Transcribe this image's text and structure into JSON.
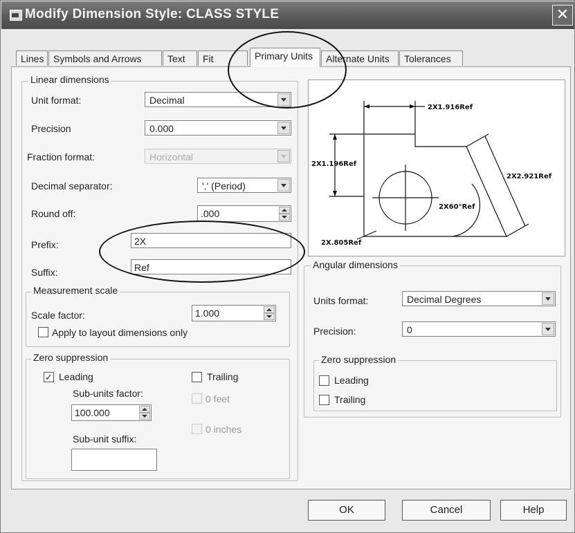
{
  "title": "Modify Dimension Style: CLASS STYLE",
  "tabs": [
    "Lines",
    "Symbols and Arrows",
    "Text",
    "Fit",
    "Primary Units",
    "Alternate Units",
    "Tolerances"
  ],
  "linear": {
    "group_label": "Linear dimensions",
    "unit_format_label": "Unit format:",
    "unit_format_value": "Decimal",
    "precision_label": "Precision",
    "precision_value": "0.000",
    "fraction_format_label": "Fraction format:",
    "fraction_format_value": "Horizontal",
    "decimal_separator_label": "Decimal separator:",
    "decimal_separator_value": "'.' (Period)",
    "round_off_label": "Round off:",
    "round_off_value": ".000",
    "prefix_label": "Prefix:",
    "prefix_value": "2X",
    "suffix_label": "Suffix:",
    "suffix_value": "Ref"
  },
  "measurement": {
    "group_label": "Measurement scale",
    "scale_factor_label": "Scale factor:",
    "scale_factor_value": "1.000",
    "apply_layout_label": "Apply to layout dimensions only",
    "apply_layout_checked": false
  },
  "zero_suppression_linear": {
    "group_label": "Zero suppression",
    "leading_label": "Leading",
    "leading_checked": true,
    "trailing_label": "Trailing",
    "trailing_checked": false,
    "sub_units_factor_label": "Sub-units factor:",
    "sub_units_factor_value": "100.000",
    "zero_feet_label": "0 feet",
    "zero_inches_label": "0 inches",
    "sub_unit_suffix_label": "Sub-unit suffix:",
    "sub_unit_suffix_value": ""
  },
  "preview": {
    "dim_top": "2X1.916Ref",
    "dim_left": "2X1.196Ref",
    "dim_right": "2X2.921Ref",
    "dim_angle": "2X60°Ref",
    "dim_radius": "2X.805Ref"
  },
  "angular": {
    "group_label": "Angular dimensions",
    "units_format_label": "Units format:",
    "units_format_value": "Decimal Degrees",
    "precision_label": "Precision:",
    "precision_value": "0",
    "zero_group_label": "Zero suppression",
    "leading_label": "Leading",
    "trailing_label": "Trailing"
  },
  "buttons": {
    "ok": "OK",
    "cancel": "Cancel",
    "help": "Help"
  },
  "close_glyph": "✕"
}
